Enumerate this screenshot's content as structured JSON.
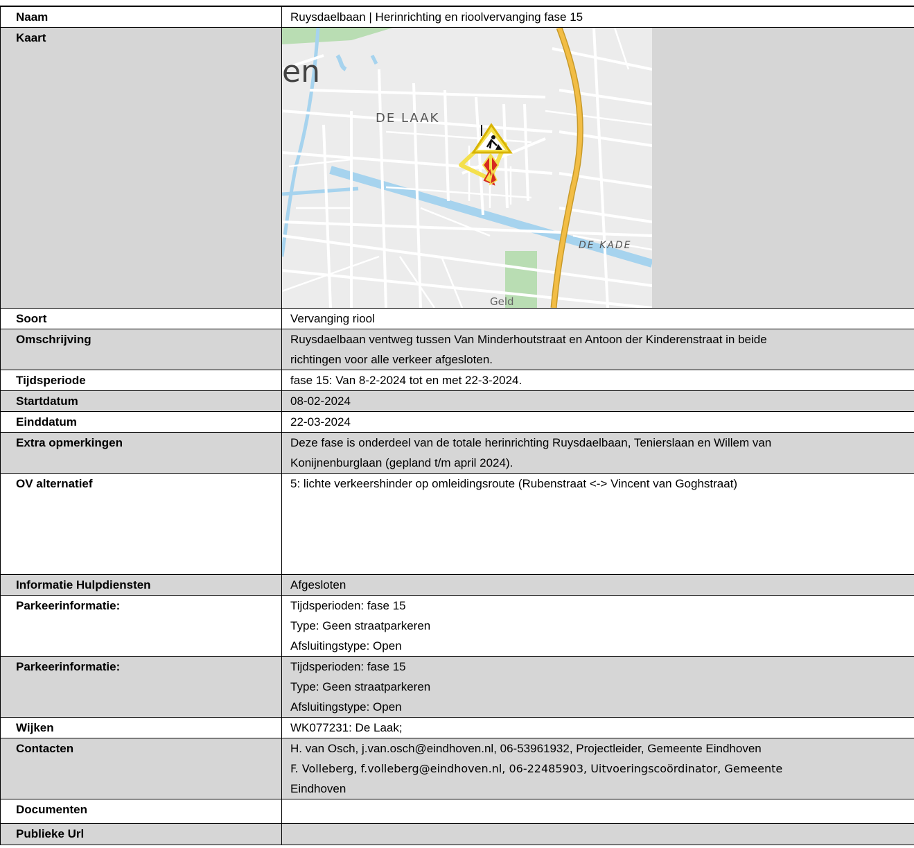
{
  "rows": [
    {
      "label": "Naam",
      "value": "Ruysdaelbaan | Herinrichting en rioolvervanging fase 15"
    },
    {
      "label": "Kaart",
      "map": {
        "labels": {
          "city": "en",
          "district1": "DE LAAK",
          "district2": "DE KADE",
          "park": "Geld"
        },
        "colors": {
          "background": "#ececec",
          "road": "#ffffff",
          "water": "#a6d3ee",
          "highway": "#f2bd45",
          "park": "#b9ddb3",
          "marker": "#f4e04d",
          "hazard": "#d62a20"
        },
        "icons": [
          "roadwork-warning-icon",
          "closure-arrow-icon"
        ]
      }
    },
    {
      "label": "Soort",
      "value": "Vervanging riool"
    },
    {
      "label": "Omschrijving",
      "lines": [
        "Ruysdaelbaan ventweg tussen Van Minderhoutstraat en Antoon der Kinderenstraat in beide",
        "richtingen voor alle verkeer afgesloten."
      ]
    },
    {
      "label": "Tijdsperiode",
      "value": "fase 15: Van 8-2-2024 tot en met 22-3-2024."
    },
    {
      "label": "Startdatum",
      "value": "08-02-2024"
    },
    {
      "label": "Einddatum",
      "value": "22-03-2024"
    },
    {
      "label": "Extra opmerkingen",
      "lines": [
        "Deze fase is onderdeel van de totale herinrichting Ruysdaelbaan, Tenierslaan en Willem van",
        "Konijnenburglaan (gepland t/m april 2024)."
      ]
    },
    {
      "label": "OV alternatief",
      "value": "5: lichte verkeershinder op omleidingsroute (Rubenstraat <-> Vincent van Goghstraat)"
    },
    {
      "label": "Informatie Hulpdiensten",
      "value": "Afgesloten"
    },
    {
      "label": "Parkeerinformatie:",
      "lines": [
        "Tijdsperioden: fase 15",
        "Type: Geen straatparkeren",
        "Afsluitingstype: Open"
      ]
    },
    {
      "label": "Parkeerinformatie:",
      "lines": [
        "Tijdsperioden: fase 15",
        "Type: Geen straatparkeren",
        "Afsluitingstype: Open"
      ]
    },
    {
      "label": "Wijken",
      "value": "WK077231: De Laak;"
    },
    {
      "label": "Contacten",
      "lines": [
        "H. van Osch, j.van.osch@eindhoven.nl, 06-53961932, Projectleider, Gemeente Eindhoven",
        "F. Volleberg, f.volleberg@eindhoven.nl, 06-22485903, Uitvoeringscoördinator, Gemeente",
        "Eindhoven"
      ]
    },
    {
      "label": "Documenten",
      "value": ""
    },
    {
      "label": "Publieke Url",
      "value": ""
    }
  ]
}
